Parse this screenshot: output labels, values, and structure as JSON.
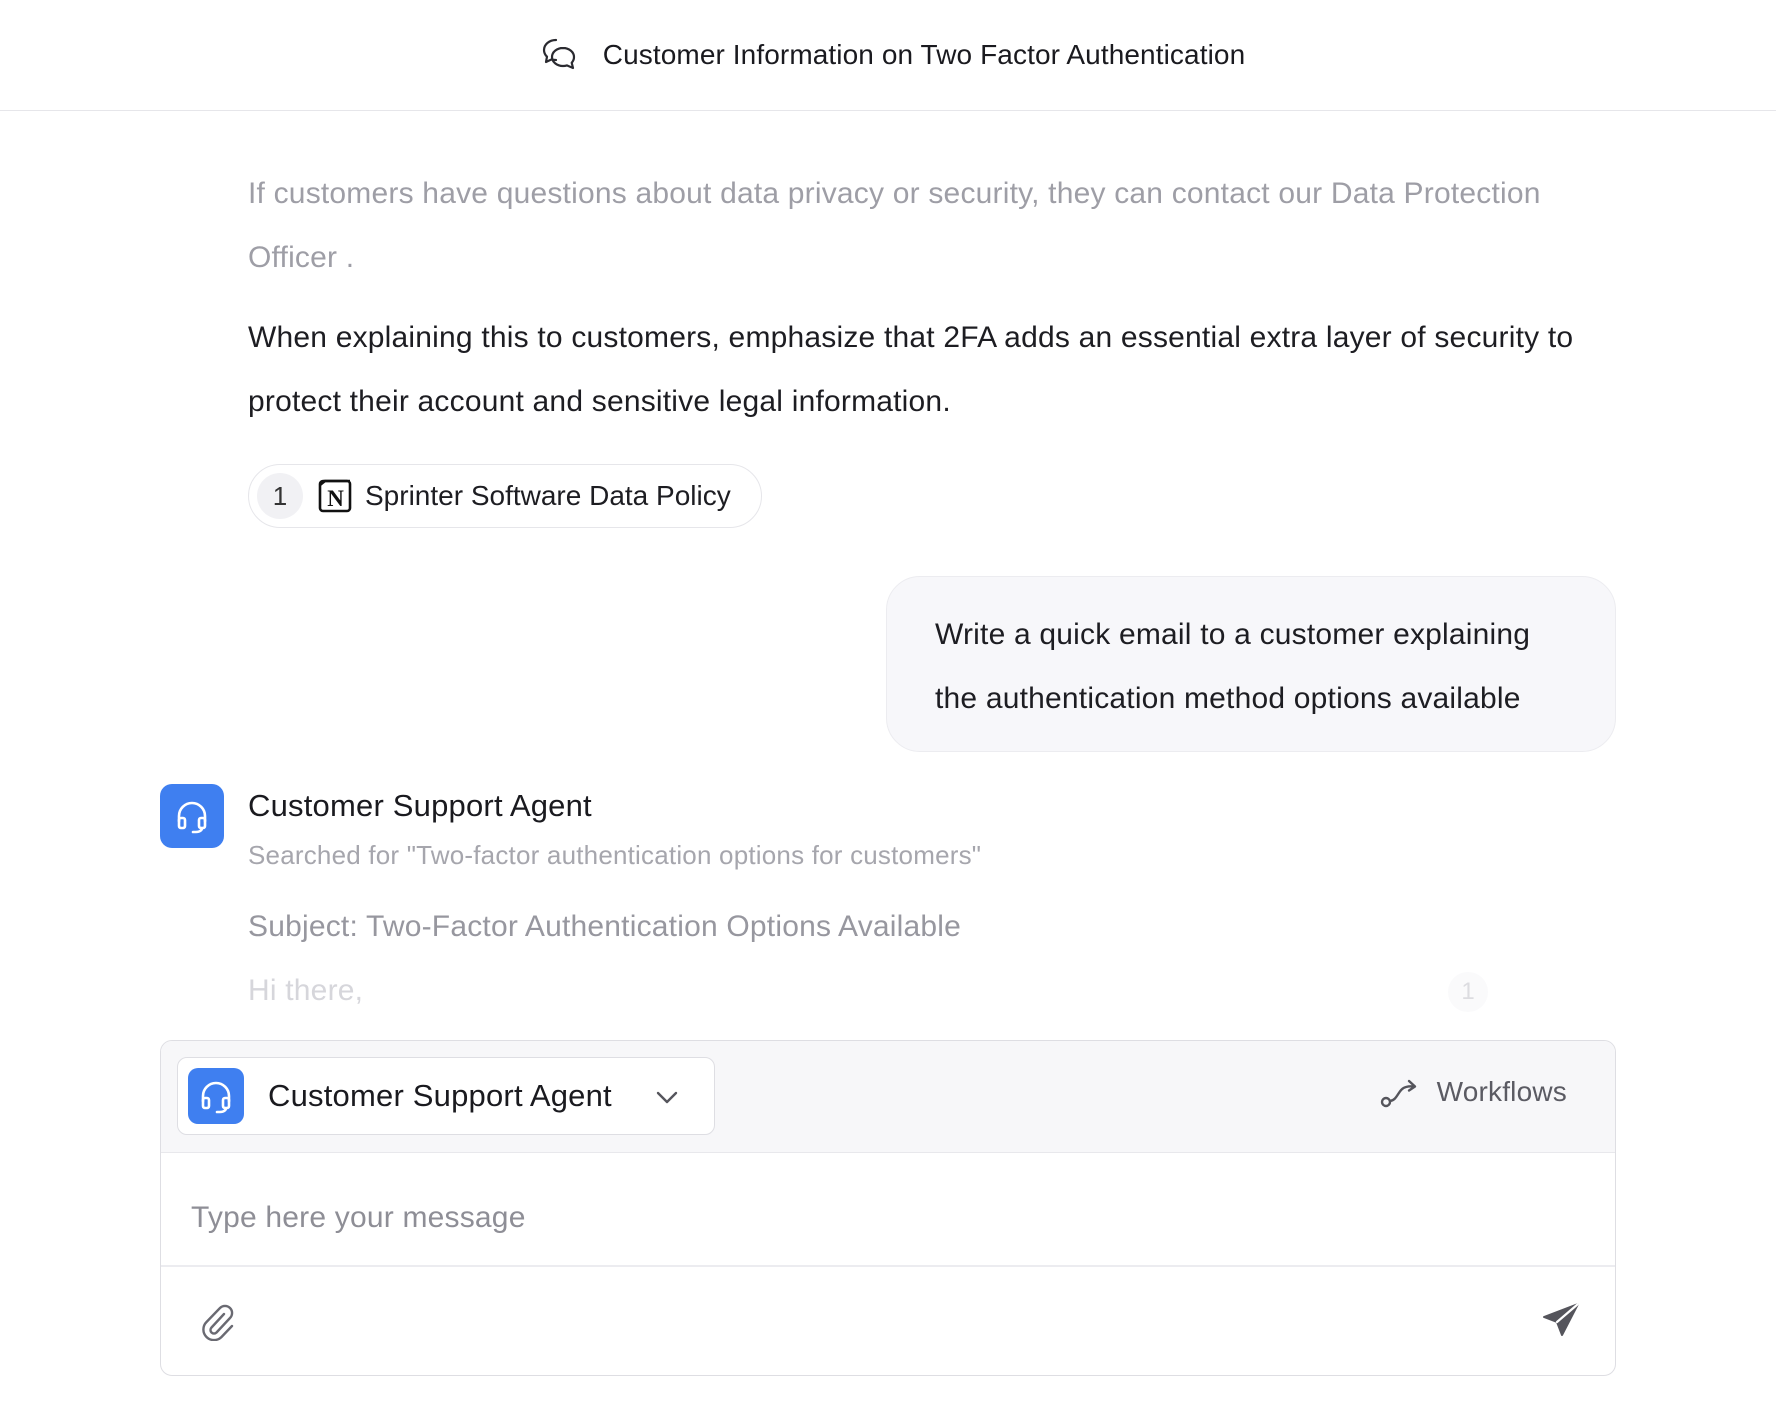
{
  "header": {
    "title": "Customer Information on Two Factor Authentication",
    "icon": "chat-bubbles-icon"
  },
  "conversation": {
    "faded_paragraph": "If customers have questions about data privacy or security, they can contact our Data Protection Officer .",
    "main_paragraph": "When explaining this to customers, emphasize that 2FA adds an essential extra layer of security to protect their account and sensitive legal information.",
    "source": {
      "number": "1",
      "icon": "notion-icon",
      "label": "Sprinter Software Data Policy"
    },
    "user_message": "Write a quick email to a customer explaining the authentication method options available",
    "agent": {
      "name": "Customer Support Agent",
      "status": "Searched for \"Two-factor authentication options for customers\"",
      "icon": "headset-icon",
      "accent": "#3f7ff0"
    },
    "email_subject": "Subject: Two-Factor Authentication Options Available",
    "email_greeting": "Hi there,",
    "faded_ref_number": "1"
  },
  "composer": {
    "agent_selector": {
      "label": "Customer Support Agent",
      "icon": "headset-icon"
    },
    "workflows_label": "Workflows",
    "message_placeholder": "Type here your message",
    "message_value": "",
    "attach_icon": "paperclip-icon",
    "send_icon": "send-icon"
  }
}
